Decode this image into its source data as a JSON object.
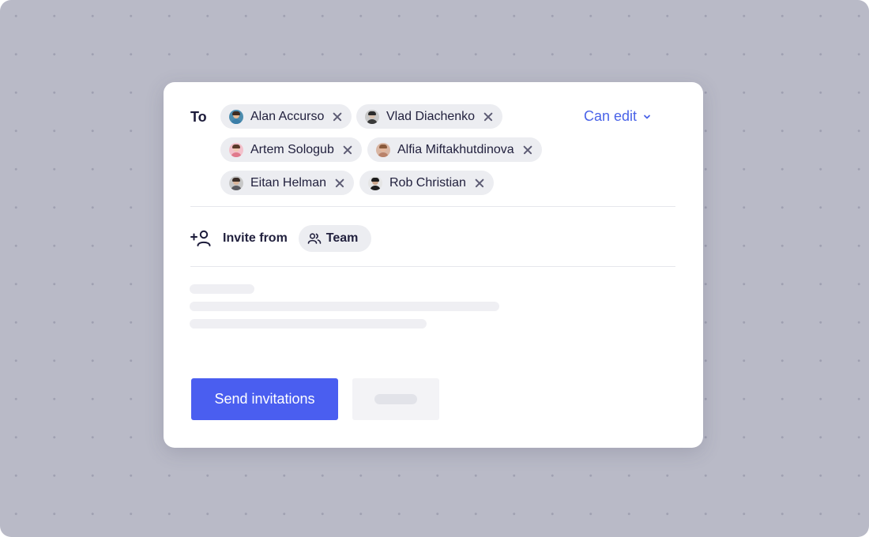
{
  "dialog": {
    "to_label": "To",
    "recipients": [
      {
        "name": "Alan Accurso",
        "skin": "#e6b992",
        "hair": "#3d2b20",
        "shirt": "#3b7ea8",
        "bg": "#4c8cae"
      },
      {
        "name": "Vlad Diachenko",
        "skin": "#d8c0ad",
        "hair": "#2b2b2b",
        "shirt": "#3a3a3a",
        "bg": "#c9c9c9"
      },
      {
        "name": "Artem Sologub",
        "skin": "#efc7b2",
        "hair": "#5a3a2a",
        "shirt": "#e07a8c",
        "bg": "#f3c1cb"
      },
      {
        "name": "Alfia Miftakhutdinova",
        "skin": "#e4b69b",
        "hair": "#8a5a3c",
        "shirt": "#b9826a",
        "bg": "#d9b6a3"
      },
      {
        "name": "Eitan Helman",
        "skin": "#d9b49a",
        "hair": "#3a2d27",
        "shirt": "#5b5b60",
        "bg": "#c7c7c7"
      },
      {
        "name": "Rob Christian",
        "skin": "#caa58b",
        "hair": "#1c1c1c",
        "shirt": "#1f1f1f",
        "bg": "#e5e5e5"
      }
    ],
    "permission": {
      "label": "Can edit",
      "icon": "chevron-down-icon"
    },
    "invite": {
      "label": "Invite from",
      "icon": "add-user-icon",
      "source_label": "Team",
      "source_icon": "team-icon"
    },
    "send_label": "Send invitations"
  },
  "colors": {
    "accent": "#4a5ef0",
    "link": "#4a63e8",
    "chip_bg": "#ecedf1",
    "backdrop": "#b9bac7"
  }
}
